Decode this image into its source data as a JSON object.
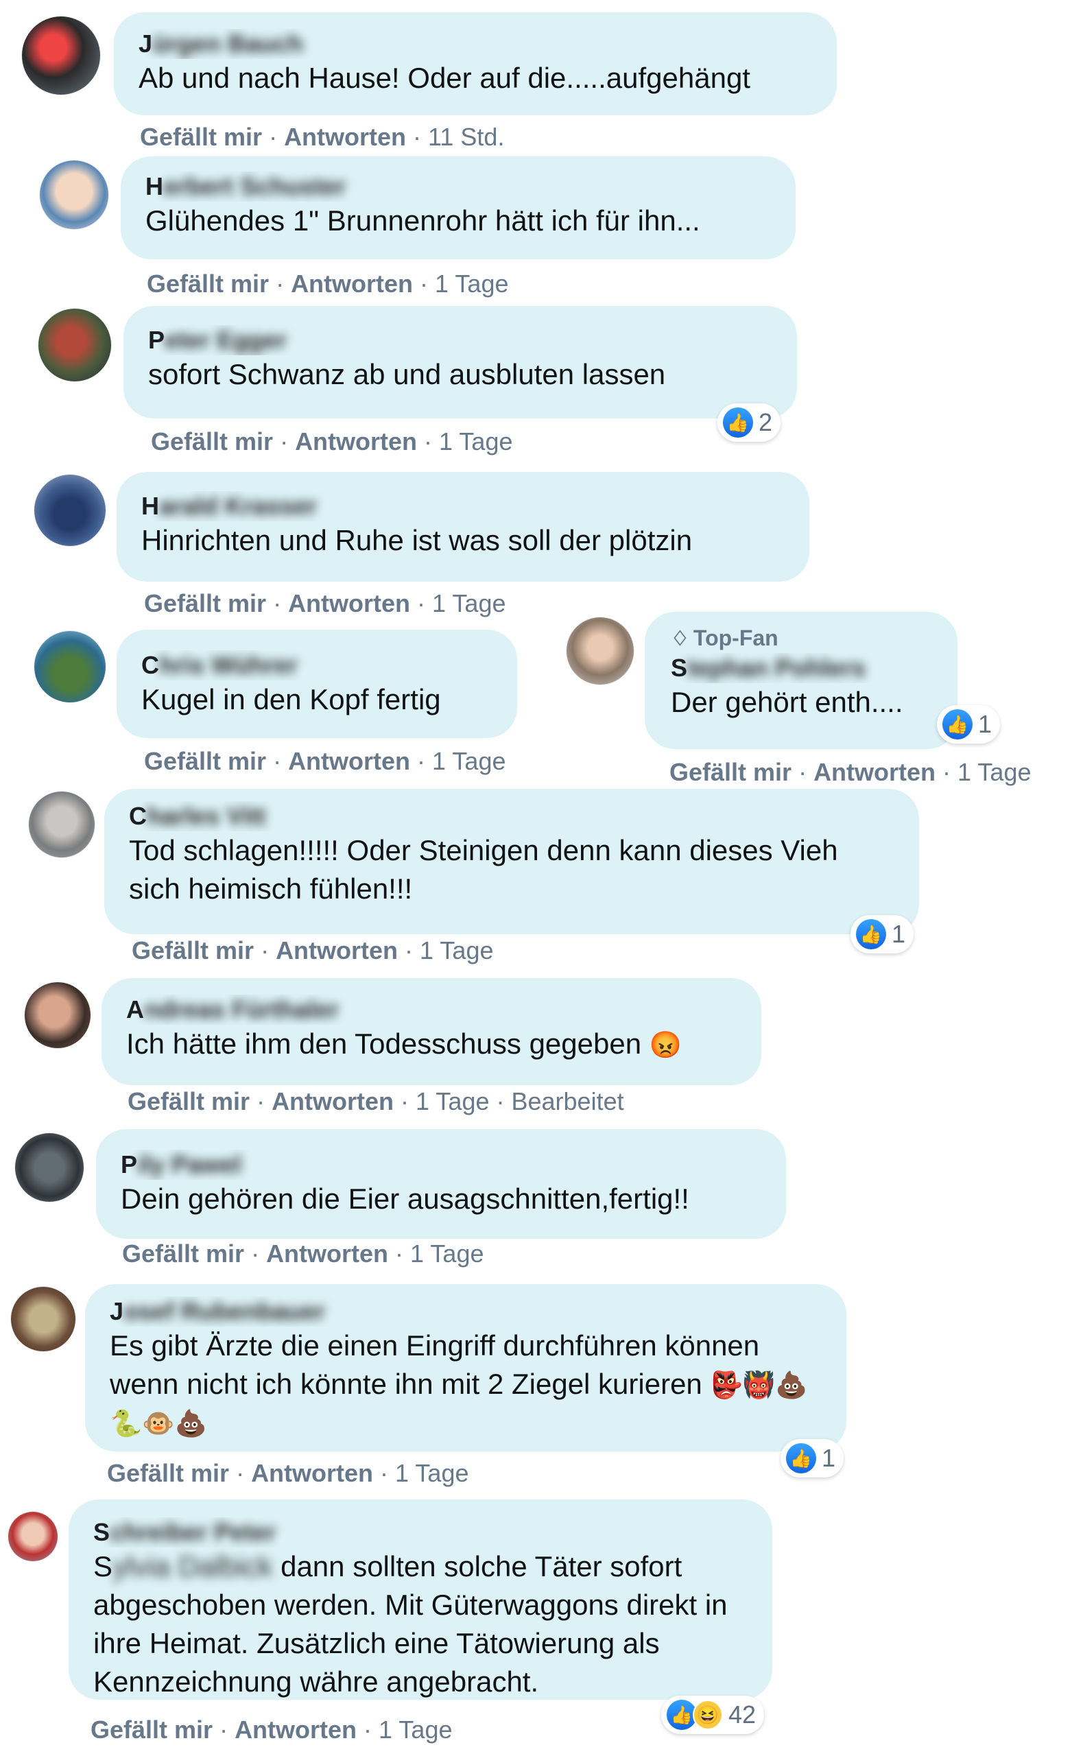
{
  "ui": {
    "like_label": "Gefällt mir",
    "reply_label": "Antworten",
    "separator": " · ",
    "topfan_label": "Top-Fan",
    "edited_label": "Bearbeitet"
  },
  "comments": [
    {
      "name_initial": "J",
      "name_rest": "ürgen Bauch",
      "text": "Ab und nach Hause! Oder auf die.....aufgehängt",
      "time": "11 Std.",
      "reactions": null
    },
    {
      "name_initial": "H",
      "name_rest": "erbert Schuster",
      "text": "Glühendes 1\" Brunnenrohr hätt ich für ihn...",
      "time": "1 Tage",
      "reactions": null
    },
    {
      "name_initial": "P",
      "name_rest": "eter Egger",
      "text": "sofort Schwanz ab und ausbluten lassen",
      "time": "1 Tage",
      "reactions": "2"
    },
    {
      "name_initial": "H",
      "name_rest": "arald Krasser",
      "text": "Hinrichten und Ruhe ist was soll der plötzin",
      "time": "1 Tage",
      "reactions": null
    },
    {
      "name_initial": "C",
      "name_rest": "hris Wührer",
      "text": "Kugel in den Kopf fertig",
      "time": "1 Tage",
      "reactions": null
    },
    {
      "name_initial": "S",
      "name_rest": "tephan Pohlers",
      "text": "Der gehört enth....",
      "time": "1 Tage",
      "reactions": "1",
      "topfan": true
    },
    {
      "name_initial": "C",
      "name_rest": "harles Vitt",
      "text_line1": "Tod schlagen!!!!! Oder Steinigen denn kann dieses Vieh",
      "text_line2": "sich heimisch fühlen!!!",
      "time": "1 Tage",
      "reactions": "1"
    },
    {
      "name_initial": "A",
      "name_rest": "ndreas Fürthaler",
      "text": "Ich hätte ihm den Todesschuss gegeben",
      "emoji": "😡",
      "time": "1 Tage",
      "reactions": null
    },
    {
      "name_initial": "P",
      "name_rest": "ily Pawel",
      "text": "Dein gehören die Eier ausagschnitten,fertig!!",
      "time": "1 Tage",
      "reactions": null
    },
    {
      "name_initial": "J",
      "name_rest": "osef Rubenbauer",
      "text_line1": "Es gibt Ärzte die einen Eingriff durchführen können",
      "text_line2": "wenn nicht ich könnte ihn mit 2 Ziegel kurieren",
      "emoji_line2": "👺👹💩",
      "emoji_line3": "🐍🐵💩",
      "time": "1 Tage",
      "reactions": "1"
    },
    {
      "name_initial": "S",
      "name_rest": "chreiber Peter",
      "mention_initial": "S",
      "mention_rest": "ylvia Dalbick",
      "text_line1": "dann sollten solche Täter sofort",
      "text_line2": "abgeschoben werden. Mit Güterwaggons direkt in",
      "text_line3": "ihre Heimat. Zusätzlich eine Tätowierung als",
      "text_line4": "Kennzeichnung währe angebracht.",
      "time": "1 Tage",
      "reactions": "42"
    }
  ]
}
